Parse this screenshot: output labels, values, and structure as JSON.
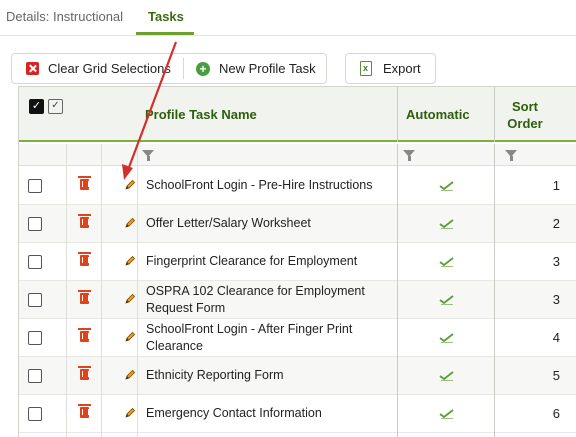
{
  "tabs": [
    {
      "label": "Details: Instructional",
      "active": false
    },
    {
      "label": "Tasks",
      "active": true
    }
  ],
  "toolbar": {
    "clear_label": "Clear Grid Selections",
    "new_task_label": "New Profile Task",
    "export_label": "Export"
  },
  "grid": {
    "columns": {
      "name": "Profile Task Name",
      "automatic": "Automatic",
      "sort_order": "Sort Order"
    },
    "rows": [
      {
        "name": "SchoolFront Login - Pre-Hire Instructions",
        "automatic": true,
        "sort_order": "1"
      },
      {
        "name": "Offer Letter/Salary Worksheet",
        "automatic": true,
        "sort_order": "2"
      },
      {
        "name": "Fingerprint Clearance for Employment",
        "automatic": true,
        "sort_order": "3"
      },
      {
        "name": "OSPRA 102 Clearance for Employment Request Form",
        "automatic": true,
        "sort_order": "3"
      },
      {
        "name": "SchoolFront Login - After Finger Print Clearance",
        "automatic": true,
        "sort_order": "4"
      },
      {
        "name": "Ethnicity Reporting Form",
        "automatic": true,
        "sort_order": "5"
      },
      {
        "name": "Emergency Contact Information",
        "automatic": true,
        "sort_order": "6"
      }
    ]
  },
  "colors": {
    "accent": "#6da02c",
    "header_text": "#2e5f0e",
    "delete_icon": "#e0421a",
    "annotation_arrow": "#d32f2f"
  }
}
